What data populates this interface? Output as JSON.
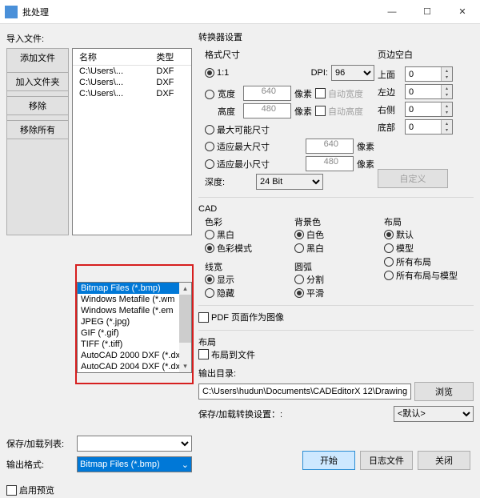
{
  "window": {
    "title": "批处理"
  },
  "left": {
    "import_label": "导入文件:",
    "btn_add_file": "添加文件",
    "btn_add_folder": "加入文件夹",
    "btn_remove": "移除",
    "btn_remove_all": "移除所有",
    "col_name": "名称",
    "col_type": "类型",
    "files": [
      {
        "name": "C:\\Users\\...",
        "type": "DXF"
      },
      {
        "name": "C:\\Users\\...",
        "type": "DXF"
      },
      {
        "name": "C:\\Users\\...",
        "type": "DXF"
      }
    ],
    "save_list_label": "保存/加载列表:",
    "output_format_label": "输出格式:",
    "output_format_value": "Bitmap Files (*.bmp)",
    "dropdown_options": [
      "Bitmap Files (*.bmp)",
      "Windows Metafile (*.wm",
      "Windows Metafile (*.em",
      "JPEG (*.jpg)",
      "GIF (*.gif)",
      "TIFF (*.tiff)",
      "AutoCAD 2000 DXF (*.dx",
      "AutoCAD 2004 DXF (*.dx"
    ],
    "enable_preview": "启用预览"
  },
  "right": {
    "converter_settings": "转换器设置",
    "format_size": "格式尺寸",
    "ratio_1_1": "1:1",
    "dpi_label": "DPI:",
    "dpi_value": "96",
    "width_label": "宽度",
    "width_value": "640",
    "height_label": "高度",
    "height_value": "480",
    "px": "像素",
    "auto_width": "自动宽度",
    "auto_height": "自动高度",
    "max_size": "最大可能尺寸",
    "fit_max": "适应最大尺寸",
    "fit_max_value": "640",
    "fit_min": "适应最小尺寸",
    "fit_min_value": "480",
    "depth_label": "深度:",
    "depth_value": "24 Bit",
    "margin_label": "页边空白",
    "margin_top": "上面",
    "margin_top_v": "0",
    "margin_left": "左边",
    "margin_left_v": "0",
    "margin_right": "右侧",
    "margin_right_v": "0",
    "margin_bottom": "底部",
    "margin_bottom_v": "0",
    "btn_custom": "自定义",
    "cad": "CAD",
    "color_scheme": "色彩",
    "color_bw": "黑白",
    "color_mode": "色彩模式",
    "bg_color": "背景色",
    "bg_white": "白色",
    "bg_black": "黑白",
    "linew": "线宽",
    "linew_show": "显示",
    "linew_hide": "隐藏",
    "arc": "圆弧",
    "arc_split": "分割",
    "arc_smooth": "平滑",
    "layout": "布局",
    "layout_default": "默认",
    "layout_model": "模型",
    "layout_all": "所有布局",
    "layout_all_model": "所有布局与模型",
    "pdf_as_image": "PDF 页面作为图像",
    "layout_section": "布局",
    "layout_to_file": "布局到文件",
    "output_dir_label": "输出目录:",
    "output_dir_value": "C:\\Users\\hudun\\Documents\\CADEditorX 12\\Drawing",
    "btn_browse": "浏览",
    "save_load_settings": "保存/加载转换设置：:",
    "save_load_value": "<默认>",
    "btn_start": "开始",
    "btn_log": "日志文件",
    "btn_close": "关闭"
  }
}
